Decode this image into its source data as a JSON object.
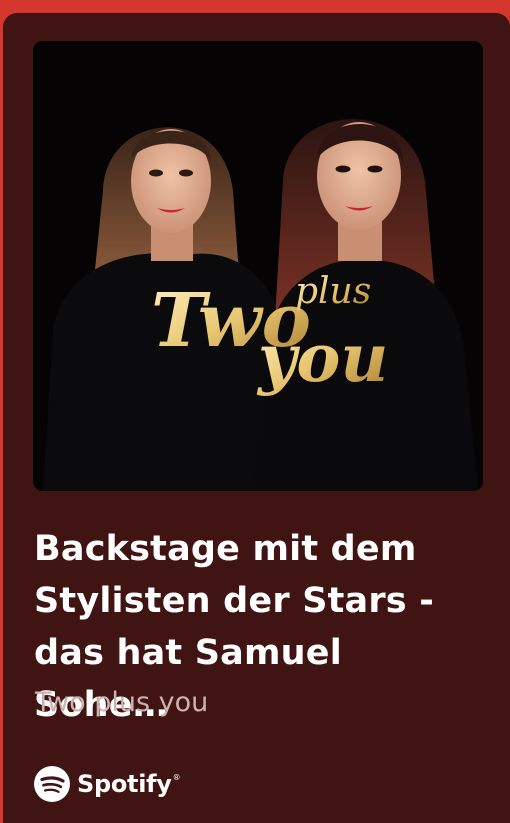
{
  "episode": {
    "title": "Backstage mit dem\nStylisten der Stars -\ndas hat Samuel Sohe…",
    "show_name": "Two plus you"
  },
  "cover_art": {
    "logo_line1": "Two",
    "logo_plus": "plus",
    "logo_line2": "you"
  },
  "brand": {
    "name": "Spotify",
    "trademark": "®",
    "icon": "spotify-logo-icon"
  },
  "colors": {
    "page_background": "#d5372f",
    "card_background": "#3f1412",
    "title_text": "#ffffff",
    "subtitle_text": "#cdb3b0",
    "logo_gold": "#e9c772"
  }
}
